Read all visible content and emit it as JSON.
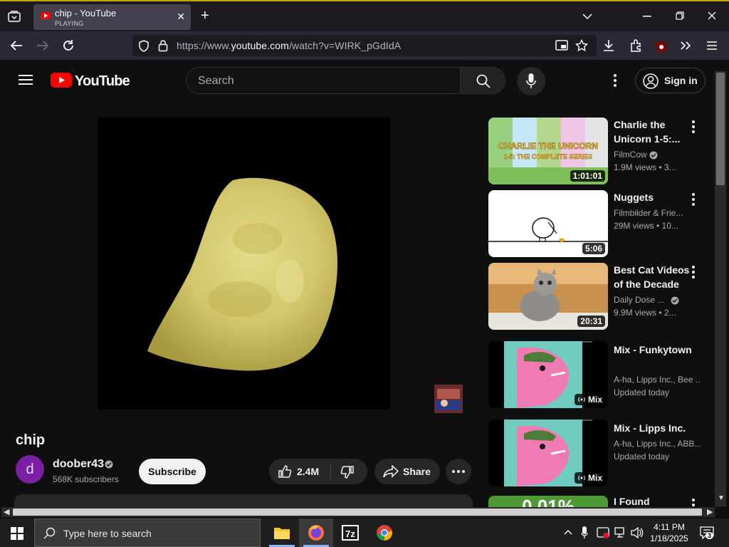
{
  "browser": {
    "tab_title": "chip - YouTube",
    "tab_status": "PLAYING",
    "url_prefix": "https://www.",
    "url_domain": "youtube.com",
    "url_path": "/watch?v=WIRK_pGdIdA",
    "extension_badge": "62"
  },
  "youtube": {
    "logo_text": "YouTube",
    "search_placeholder": "Search",
    "sign_in_label": "Sign in"
  },
  "video": {
    "title": "chip",
    "channel_initial": "d",
    "channel_name": "doober43",
    "subscribers": "568K subscribers",
    "subscribe_label": "Subscribe",
    "like_count": "2.4M",
    "share_label": "Share"
  },
  "recommendations": [
    {
      "title": "Charlie the Unicorn 1-5:...",
      "channel": "FilmCow",
      "verified": true,
      "meta": "1.9M views • 3...",
      "duration": "1:01:01",
      "thumb_text_1": "CHARLIE THE UNICORN",
      "thumb_text_2": "1-5: THE COMPLETE SERIES"
    },
    {
      "title": "Nuggets",
      "channel": "Filmbilder & Frie...",
      "verified": false,
      "meta": "29M views • 10...",
      "duration": "5:06"
    },
    {
      "title": "Best Cat Videos of the Decade",
      "channel": "Daily Dose ...",
      "verified": true,
      "meta": "9.9M views • 2...",
      "duration": "20:31"
    },
    {
      "title": "Mix - Funkytown",
      "channel": "A-ha, Lipps Inc., Bee ...",
      "verified": false,
      "meta": "Updated today",
      "duration": "Mix"
    },
    {
      "title": "Mix - Lipps Inc.",
      "channel": "A-ha, Lipps Inc., ABB...",
      "verified": false,
      "meta": "Updated today",
      "duration": "Mix"
    },
    {
      "title": "I Found",
      "thumb_text": "0.01%"
    }
  ],
  "taskbar": {
    "search_placeholder": "Type here to search",
    "time": "4:11 PM",
    "date": "1/18/2025",
    "notification_count": "3"
  },
  "colors": {
    "youtube_red": "#ff0000",
    "page_bg": "#0f0f0f",
    "browser_tab_active": "#42414d",
    "avatar": "#7b1fa2"
  }
}
